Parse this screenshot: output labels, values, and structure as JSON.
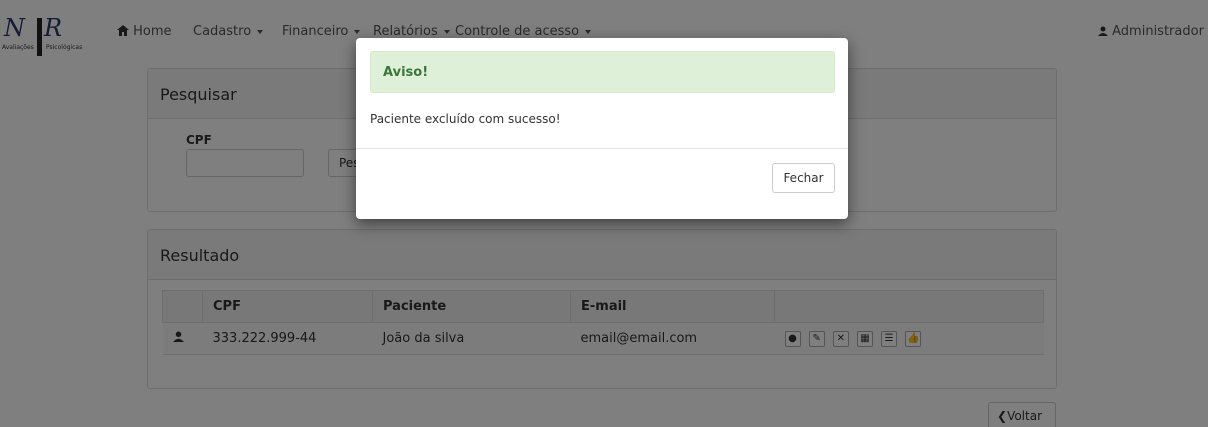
{
  "navbar": {
    "logo_tagline_left": "Avaliações",
    "logo_tagline_right": "Psicológicas",
    "home": "Home",
    "cadastro": "Cadastro",
    "financeiro": "Financeiro",
    "relatorios": "Relatórios",
    "controle": "Controle de acesso",
    "user": "Administrador"
  },
  "search_panel": {
    "title": "Pesquisar",
    "cpf_label": "CPF",
    "cpf_value": "",
    "button": "Pesquisar"
  },
  "result_panel": {
    "title": "Resultado",
    "columns": [
      "",
      "CPF",
      "Paciente",
      "E-mail",
      ""
    ],
    "rows": [
      {
        "cpf": "333.222.999-44",
        "paciente": "João da silva",
        "email": "email@email.com"
      }
    ]
  },
  "back_button": "Voltar",
  "modal": {
    "alert": "Aviso!",
    "message": "Paciente excluído com sucesso!",
    "close": "Fechar"
  }
}
